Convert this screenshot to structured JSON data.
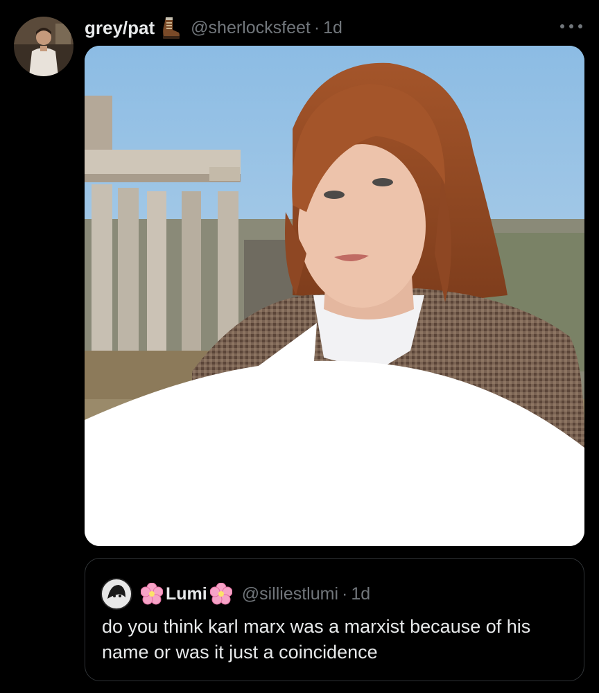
{
  "tweet": {
    "author_name": "grey/pat",
    "author_icon": "hiking-boot-icon",
    "author_handle": "@sherlocksfeet",
    "separator": "·",
    "time": "1d",
    "media_alt": "photo of a woman with auburn hair standing before Roman ruins, with a blank white speech bubble"
  },
  "quote": {
    "author_name": "Lumi",
    "author_decorations": [
      "cherry-blossom-icon",
      "cherry-blossom-icon"
    ],
    "author_handle": "@silliestlumi",
    "separator": "·",
    "time": "1d",
    "text": "do you think karl marx was a marxist because of his name or was it just a coincidence"
  },
  "colors": {
    "background": "#000000",
    "primary_text": "#e7e9ea",
    "secondary_text": "#71767b",
    "border": "#2f3336"
  }
}
